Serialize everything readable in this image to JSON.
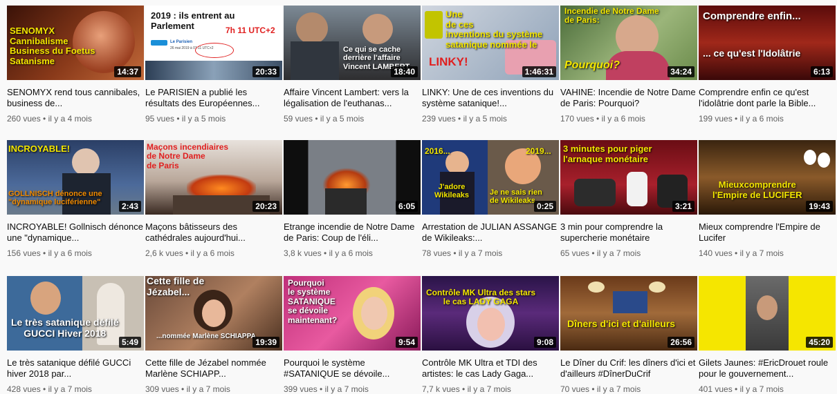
{
  "videos": [
    {
      "overlay": "SENOMYX\nCannibalisme\nBusiness du Foetus\nSatanisme",
      "duration": "14:37",
      "title": "SENOMYX rend tous cannibales, business de...",
      "views": "260 vues",
      "age": "il y a 4 mois"
    },
    {
      "overlay": "2019 : ils entrent au\nParlement",
      "overlay2": "7h 11 UTC+2",
      "overlay3": "Le Parisien",
      "overlay4": "26 mai 2019 à 07:11 UTC+2",
      "duration": "20:33",
      "title": "Le PARISIEN a publié les résultats des Européennes...",
      "views": "95 vues",
      "age": "il y a 5 mois"
    },
    {
      "overlay": "Ce qui se cache\nderrière l'affaire\nVincent LAMBERT",
      "duration": "18:40",
      "title": "Affaire Vincent Lambert: vers la légalisation de l'euthanas...",
      "views": "59 vues",
      "age": "il y a 5 mois"
    },
    {
      "overlay": "Une\nde ces\ninventions du système\nsatanique nommée le",
      "overlay2": "LINKY!",
      "duration": "1:46:31",
      "title": "LINKY: Une de ces inventions du système satanique!...",
      "views": "239 vues",
      "age": "il y a 5 mois"
    },
    {
      "overlay": "Incendie de Notre Dame\nde Paris:",
      "overlay2": "Pourquoi?",
      "duration": "34:24",
      "title": "VAHINE: Incendie de Notre Dame de Paris: Pourquoi?",
      "views": "170 vues",
      "age": "il y a 6 mois"
    },
    {
      "overlay": "Comprendre enfin...",
      "overlay2": "... ce qu'est l'Idolâtrie",
      "duration": "6:13",
      "title": "Comprendre enfin ce qu'est l'idolâtrie dont parle la Bible...",
      "views": "199 vues",
      "age": "il y a 6 mois"
    },
    {
      "overlay": "INCROYABLE!",
      "overlay2": "GOLLNISCH dénonce une\n\"dynamique luciférienne\"",
      "duration": "2:43",
      "title": "INCROYABLE! Gollnisch dénonce une \"dynamique...",
      "views": "156 vues",
      "age": "il y a 6 mois"
    },
    {
      "overlay": "Maçons incendiaires\nde Notre Dame\nde Paris",
      "duration": "20:23",
      "title": "Maçons bâtisseurs des cathédrales aujourd'hui...",
      "views": "2,6 k vues",
      "age": "il y a 6 mois"
    },
    {
      "overlay": "",
      "duration": "6:05",
      "title": "Etrange incendie de Notre Dame de Paris: Coup de l'éli...",
      "views": "3,8 k vues",
      "age": "il y a 6 mois"
    },
    {
      "overlay": "2016...",
      "overlay2": "2019...",
      "overlay3": "J'adore\nWikileaks",
      "overlay4": "Je ne sais rien\nde Wikileaks",
      "duration": "0:25",
      "title": "Arrestation de JULIAN ASSANGE de Wikileaks:...",
      "views": "78 vues",
      "age": "il y a 7 mois"
    },
    {
      "overlay": "3 minutes pour piger\nl'arnaque monétaire",
      "duration": "3:21",
      "title": "3 min pour comprendre la supercherie monétaire",
      "views": "65 vues",
      "age": "il y a 7 mois"
    },
    {
      "overlay": "Mieuxcomprendre\nl'Empire de LUCIFER",
      "duration": "19:43",
      "title": "Mieux comprendre l'Empire de Lucifer",
      "views": "140 vues",
      "age": "il y a 7 mois"
    },
    {
      "overlay": "Le très satanique défilé\nGUCCI Hiver 2018",
      "duration": "5:49",
      "title": "Le très satanique défilé GUCCi hiver 2018 par...",
      "views": "428 vues",
      "age": "il y a 7 mois"
    },
    {
      "overlay": "Cette fille de\nJézabel...",
      "overlay2": "...nommée Marlène SCHIAPPA",
      "duration": "19:39",
      "title": "Cette fille de Jézabel nommée Marlène SCHIAPP...",
      "views": "309 vues",
      "age": "il y a 7 mois"
    },
    {
      "overlay": "Pourquoi\nle système\nSATANIQUE\nse dévoile\nmaintenant?",
      "duration": "9:54",
      "title": "Pourquoi le système #SATANIQUE se dévoile...",
      "views": "399 vues",
      "age": "il y a 7 mois"
    },
    {
      "overlay": "Contrôle MK Ultra des stars\nle cas LADY GAGA",
      "duration": "9:08",
      "title": "Contrôle MK Ultra et TDI des artistes: le cas Lady Gaga...",
      "views": "7,7 k vues",
      "age": "il y a 7 mois"
    },
    {
      "overlay": "Dîners d'ici et d'ailleurs",
      "duration": "26:56",
      "title": "Le Dîner du Crif: les dîners d'ici et d'ailleurs #DînerDuCrif",
      "views": "70 vues",
      "age": "il y a 7 mois"
    },
    {
      "overlay": "",
      "duration": "45:20",
      "title": "Gilets Jaunes: #EricDrouet roule pour le gouvernement...",
      "views": "401 vues",
      "age": "il y a 7 mois"
    }
  ],
  "separator": " • ",
  "colors": {
    "title": "#0d0d0d",
    "meta": "#606060",
    "background": "#f9f9f9",
    "duration_bg": "#000000",
    "yellow": "#f5e600",
    "red": "#e02020"
  }
}
